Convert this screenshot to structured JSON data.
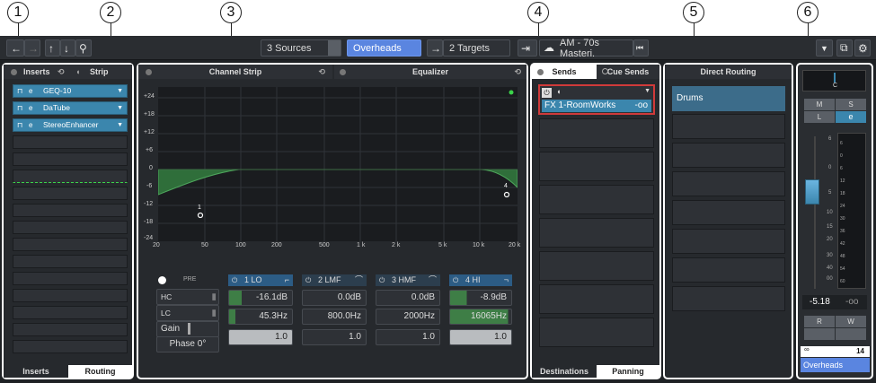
{
  "callouts": [
    "1",
    "2",
    "3",
    "4",
    "5",
    "6"
  ],
  "toolbar": {
    "sources": "3 Sources",
    "channel": "Overheads",
    "targets": "2 Targets",
    "preset": "AM - 70s Masteri."
  },
  "inserts": {
    "tab_inserts": "Inserts",
    "tab_strip": "Strip",
    "plugins": [
      "GEQ-10",
      "DaTube",
      "StereoEnhancer"
    ],
    "bottom_tabs": [
      "Inserts",
      "Routing"
    ]
  },
  "channel_strip": {
    "title": "Channel Strip"
  },
  "equalizer": {
    "title": "Equalizer",
    "y_ticks": [
      "+24",
      "+18",
      "+12",
      "+6",
      "0",
      "-6",
      "-12",
      "-18",
      "-24"
    ],
    "x_ticks": [
      "20",
      "50",
      "100",
      "200",
      "500",
      "1 k",
      "2 k",
      "5 k",
      "10 k",
      "20 k"
    ],
    "point_labels": [
      "1",
      "4"
    ],
    "pre": "PRE",
    "hc": "HC",
    "lc": "LC",
    "gain": "Gain",
    "phase": "Phase 0°",
    "bands": [
      {
        "name": "1 LO",
        "gain": "-16.1dB",
        "freq": "45.3Hz",
        "q": "1.0",
        "active": true
      },
      {
        "name": "2 LMF",
        "gain": "0.0dB",
        "freq": "800.0Hz",
        "q": "1.0",
        "active": false
      },
      {
        "name": "3 HMF",
        "gain": "0.0dB",
        "freq": "2000Hz",
        "q": "1.0",
        "active": false
      },
      {
        "name": "4 HI",
        "gain": "-8.9dB",
        "freq": "16065Hz",
        "q": "1.0",
        "active": true
      }
    ]
  },
  "sends": {
    "tab_sends": "Sends",
    "tab_cue": "Cue Sends",
    "send1": {
      "name": "FX 1-RoomWorks",
      "value": "-oo"
    },
    "bottom_tabs": [
      "Destinations",
      "Panning"
    ]
  },
  "direct_routing": {
    "title": "Direct Routing",
    "item": "Drums"
  },
  "fader": {
    "pan": "C",
    "buttons": [
      "M",
      "S",
      "L",
      "e",
      "R",
      "W"
    ],
    "scale": [
      "6",
      "0",
      "5",
      "10",
      "15",
      "20",
      "30",
      "40",
      "00"
    ],
    "meter_scale": [
      "6",
      "0",
      "6",
      "12",
      "18",
      "24",
      "30",
      "36",
      "42",
      "48",
      "54",
      "60"
    ],
    "level": "-5.18",
    "peak": "-oo",
    "channel_number": "14",
    "channel_name": "Overheads"
  },
  "colors": {
    "accent": "#3b86ad",
    "eq_fill": "#2f6e3a",
    "active_send_border": "#d03a3a"
  }
}
